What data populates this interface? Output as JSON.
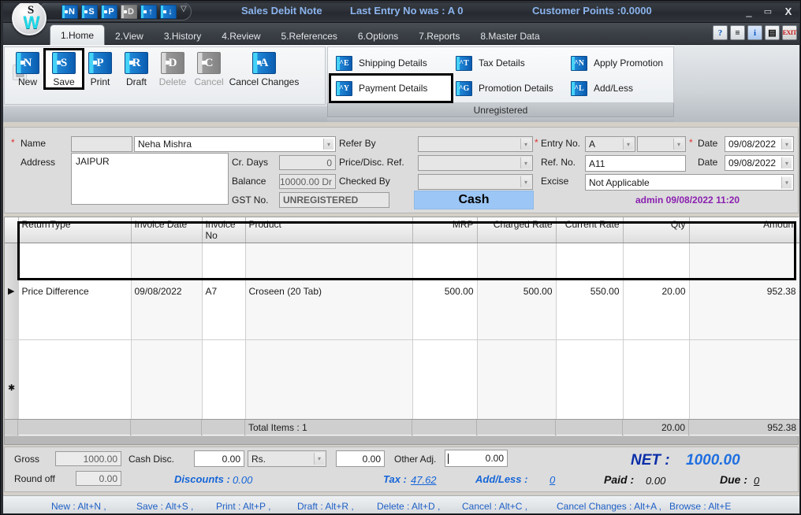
{
  "titlebar": {
    "doc_title": "Sales Debit Note",
    "last_entry": "Last Entry No was : A 0",
    "customer_points": "Customer Points :0.0000",
    "minimize": "_",
    "maximize": "▭",
    "close": "X",
    "logo_dollar": "S",
    "logo_mark": "W",
    "qat_caret": "▽",
    "qat_items": [
      {
        "name": "quick-new",
        "letter": "N",
        "disabled": false
      },
      {
        "name": "quick-save",
        "letter": "S",
        "disabled": false
      },
      {
        "name": "quick-print",
        "letter": "P",
        "disabled": false
      },
      {
        "name": "quick-draft",
        "letter": "D",
        "disabled": true
      },
      {
        "name": "quick-prev",
        "letter": "↑",
        "disabled": false
      },
      {
        "name": "quick-next",
        "letter": "↓",
        "disabled": false
      }
    ]
  },
  "tabs": [
    {
      "label": "1.Home",
      "active": true
    },
    {
      "label": "2.View",
      "active": false
    },
    {
      "label": "3.History",
      "active": false
    },
    {
      "label": "4.Review",
      "active": false
    },
    {
      "label": "5.References",
      "active": false
    },
    {
      "label": "6.Options",
      "active": false
    },
    {
      "label": "7.Reports",
      "active": false
    },
    {
      "label": "8.Master Data",
      "active": false
    }
  ],
  "tab_icons": [
    {
      "name": "help-icon",
      "glyph": "?"
    },
    {
      "name": "print-preview-icon",
      "glyph": "≡"
    },
    {
      "name": "info-icon",
      "glyph": "i"
    },
    {
      "name": "document-close-icon",
      "glyph": "▤"
    },
    {
      "name": "exit-icon",
      "glyph": "EXIT"
    }
  ],
  "ribbon": {
    "lock_icon": "ὑ2",
    "main_buttons": [
      {
        "label": "New",
        "letter": "N",
        "disabled": false,
        "selected": false
      },
      {
        "label": "Save",
        "letter": "S",
        "disabled": false,
        "selected": true
      },
      {
        "label": "Print",
        "letter": "P",
        "disabled": false,
        "selected": false
      },
      {
        "label": "Draft",
        "letter": "R",
        "disabled": false,
        "selected": false
      },
      {
        "label": "Delete",
        "letter": "D",
        "disabled": true,
        "selected": false
      },
      {
        "label": "Cancel",
        "letter": "C",
        "disabled": true,
        "selected": false
      },
      {
        "label": "Cancel Changes",
        "letter": "A",
        "disabled": false,
        "selected": false
      }
    ],
    "small_buttons": [
      {
        "label": "Shipping Details",
        "letter": "^E",
        "selected": false
      },
      {
        "label": "Tax Details",
        "letter": "^T",
        "selected": false
      },
      {
        "label": "Apply Promotion",
        "letter": "^N",
        "selected": false
      },
      {
        "label": "Payment Details",
        "letter": "^Y",
        "selected": true
      },
      {
        "label": "Promotion Details",
        "letter": "^G",
        "selected": false
      },
      {
        "label": "Add/Less",
        "letter": "^L",
        "selected": false
      }
    ],
    "group_caption": "Unregistered"
  },
  "header_form": {
    "name_label": "Name",
    "name_code_value": "",
    "name_value": "Neha Mishra",
    "address_label": "Address",
    "address_value": "JAIPUR",
    "cr_days_label": "Cr. Days",
    "cr_days_value": "0",
    "balance_label": "Balance",
    "balance_value": "10000.00 Dr",
    "gst_label": "GST No.",
    "gst_value": "UNREGISTERED",
    "refer_by_label": "Refer By",
    "refer_by_value": "",
    "price_disc_ref_label": "Price/Disc. Ref.",
    "price_disc_ref_value": "",
    "checked_by_label": "Checked By",
    "checked_by_value": "",
    "cash_button": "Cash",
    "entry_no_label": "Entry No.",
    "entry_no_series": "A",
    "entry_no_value": "",
    "ref_no_label": "Ref. No.",
    "ref_no_value": "A11",
    "excise_label": "Excise",
    "excise_value": "Not Applicable",
    "date1_label": "Date",
    "date1_value": "09/08/2022",
    "date2_label": "Date",
    "date2_value": "09/08/2022",
    "user_stamp": "admin 09/08/2022 11:20",
    "required_marker": "*"
  },
  "grid": {
    "columns": [
      {
        "label": "ReturnType",
        "align": "l"
      },
      {
        "label": "Invoice Date",
        "align": "l"
      },
      {
        "label": "Invoice No",
        "align": "l"
      },
      {
        "label": "Product",
        "align": "l"
      },
      {
        "label": "MRP",
        "align": "r"
      },
      {
        "label": "Charged Rate",
        "align": "r"
      },
      {
        "label": "Current Rate",
        "align": "r"
      },
      {
        "label": "Qty",
        "align": "r"
      },
      {
        "label": "Amount",
        "align": "r"
      }
    ],
    "rows": [
      {
        "marker": "▶",
        "cells": [
          "Price Difference",
          "09/08/2022",
          "A7",
          "Croseen (20 Tab)",
          "500.00",
          "500.00",
          "550.00",
          "20.00",
          "952.38"
        ]
      },
      {
        "marker": "✱",
        "cells": [
          "",
          "",
          "",
          "",
          "",
          "",
          "",
          "",
          ""
        ]
      }
    ],
    "total_items": "Total Items : 1",
    "total_qty": "20.00",
    "total_amount": "952.38"
  },
  "summary": {
    "gross_label": "Gross",
    "gross_value": "1000.00",
    "round_off_label": "Round off",
    "round_off_value": "0.00",
    "cash_disc_label": "Cash Disc.",
    "cash_disc_value": "0.00",
    "cash_disc_unit": "Rs.",
    "cash_disc_amount": "0.00",
    "discounts_label": "Discounts :",
    "discounts_value": "0.00",
    "other_adj_label": "Other Adj.",
    "other_adj_value": "0.00",
    "tax_label": "Tax :",
    "tax_value": "47.62",
    "add_less_label": "Add/Less :",
    "add_less_value": "0",
    "net_label": "NET :",
    "net_value": "1000.00",
    "paid_label": "Paid :",
    "paid_value": "0.00",
    "due_label": "Due :",
    "due_value": "0"
  },
  "statusbar": {
    "shortcuts": [
      "New : Alt+N ,",
      "Save : Alt+S ,",
      "Print : Alt+P ,",
      "Draft : Alt+R ,",
      "Delete : Alt+D ,",
      "Cancel : Alt+C ,",
      "Cancel Changes : Alt+A ,",
      "Browse : Alt+E"
    ]
  },
  "colors": {
    "accent_blue": "#1565d8",
    "net_blue": "#1f6fe0",
    "title_blue": "#8cb4ee",
    "stamp_purple": "#8a1faf",
    "cash_bg": "#9cc6f5",
    "required_red": "#e03030"
  }
}
